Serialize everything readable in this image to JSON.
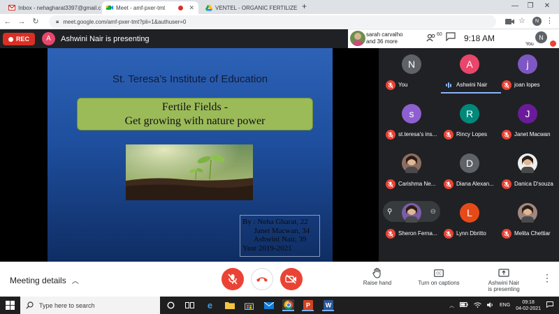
{
  "browser": {
    "tabs": [
      {
        "label": "Inbox - nehagharat3397@gmail.c",
        "icon": "gmail-icon"
      },
      {
        "label": "Meet - amf-pxer-tmt",
        "icon": "meet-icon",
        "active": true
      },
      {
        "label": "VENTEL - ORGANIC FERTILIZER.p",
        "icon": "drive-icon"
      }
    ],
    "url": "meet.google.com/amf-pxer-tmt?pli=1&authuser=0",
    "profile_initial": "N"
  },
  "meet": {
    "rec_label": "REC",
    "presenter_initial": "A",
    "presenter_text": "Ashwini Nair is presenting",
    "participants_summary_line1": "sarah carvalho",
    "participants_summary_line2": "and 36 more",
    "participant_count": "60",
    "time": "9:18 AM",
    "self_initial": "N",
    "self_label": "You"
  },
  "slide": {
    "institution": "St. Teresa’s Institute of Education",
    "title_line1": "Fertile Fields -",
    "title_line2": "Get growing with nature power",
    "credits": [
      "By : Neha Gharat, 22",
      "      Janet Macwan, 34",
      "      Ashwini Nair, 39",
      "Year 2019-2021"
    ]
  },
  "participants": [
    {
      "name": "You",
      "initial": "N",
      "color": "#5f6368"
    },
    {
      "name": "Ashwini Nair",
      "initial": "A",
      "color": "#e8466b",
      "speaking": true
    },
    {
      "name": "joan lopes",
      "initial": "j",
      "color": "#7e57c2"
    },
    {
      "name": "st.teresa's ins...",
      "initial": "s",
      "color": "#8e5fd1"
    },
    {
      "name": "Rincy Lopes",
      "initial": "R",
      "color": "#00897b"
    },
    {
      "name": "Janet Macwan",
      "initial": "J",
      "color": "#6a1b9a"
    },
    {
      "name": "Carishma Ne...",
      "initial": "",
      "color": "#8d6e63",
      "photo": true
    },
    {
      "name": "Diana Alexan...",
      "initial": "D",
      "color": "#5f6368"
    },
    {
      "name": "Danica D'souza",
      "initial": "",
      "color": "#eeeeee",
      "photo": true
    },
    {
      "name": "Sheron Ferna...",
      "initial": "",
      "color": "#7b5ea7",
      "photo": true,
      "pinned": true
    },
    {
      "name": "Lynn Dbritto",
      "initial": "L",
      "color": "#e64a19"
    },
    {
      "name": "Melita Chettiar",
      "initial": "",
      "color": "#a1887f",
      "photo": true
    }
  ],
  "controls": {
    "meeting_details": "Meeting details",
    "raise_hand": "Raise hand",
    "captions": "Turn on captions",
    "presenting_line1": "Ashwini Nair",
    "presenting_line2": "is presenting"
  },
  "taskbar": {
    "search_placeholder": "Type here to search",
    "language": "ENG",
    "clock_time": "09:18",
    "clock_date": "04-02-2021"
  },
  "colors": {
    "rec_red": "#d93025",
    "mic_off_red": "#ea4335",
    "speaking_blue": "#8ab4f8",
    "slide_green": "#9bbb59"
  }
}
